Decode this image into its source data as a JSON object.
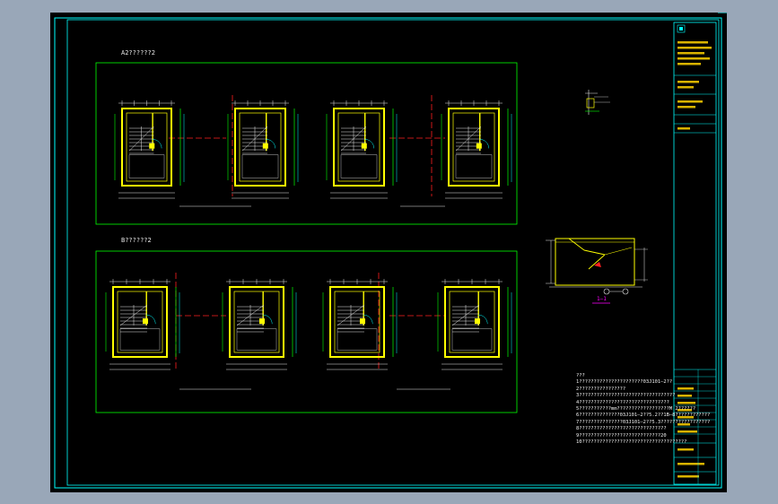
{
  "section_a_title": "A2??????2",
  "section_b_title": "B??????2",
  "notes": {
    "heading": "???",
    "lines": [
      "1??????????????????????03J101—2??",
      "2????????????????",
      "3?????????????????????????????????",
      "4???????????????????????????????",
      "5???????????mm??????????????????M 2??????",
      "6??????????????03J101—2??5.2??1B—8???????????????",
      "7???????????????03J101—2??5.3?????????????????",
      "8??????????????????????????????",
      "9????????????????????????????20",
      "10????????????????????????????????????"
    ]
  },
  "detail_label": "1—1",
  "colors": {
    "frame": "#00ffff",
    "grid_line": "#ff2020",
    "wall": "#ffff00",
    "section_border": "#00ff00"
  }
}
